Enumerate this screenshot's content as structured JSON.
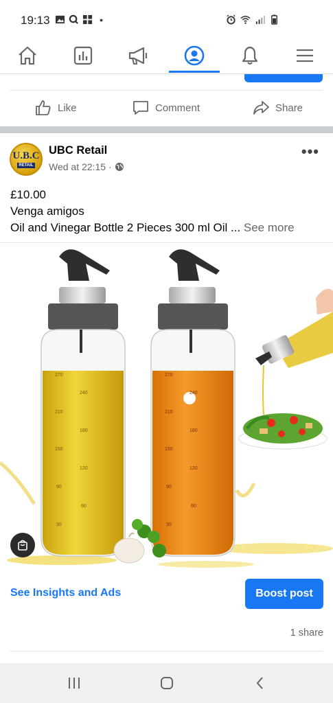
{
  "status_bar": {
    "time": "19:13"
  },
  "nav": {
    "items": [
      "home-icon",
      "pages-icon",
      "megaphone-icon",
      "profile-icon",
      "bell-icon",
      "menu-icon"
    ],
    "active_index": 3
  },
  "actions": {
    "like": "Like",
    "comment": "Comment",
    "share": "Share"
  },
  "post": {
    "page_name": "UBC Retail",
    "avatar_text": "U.B.C",
    "avatar_subtext": "RETAIL",
    "timestamp": "Wed at 22:15 ·",
    "price": "£10.00",
    "line2": "Venga amigos",
    "line3": "Oil and Vinegar Bottle 2 Pieces 300 ml Oil ...",
    "see_more": " See more",
    "bottle_scale": [
      "270",
      "240",
      "210",
      "180",
      "150",
      "120",
      "90",
      "60",
      "30"
    ]
  },
  "insights": {
    "link": "See Insights and Ads",
    "boost": "Boost post"
  },
  "shares": "1 share",
  "colors": {
    "accent": "#1877f2",
    "oil": "#d9b114",
    "vinegar": "#e8820f"
  }
}
